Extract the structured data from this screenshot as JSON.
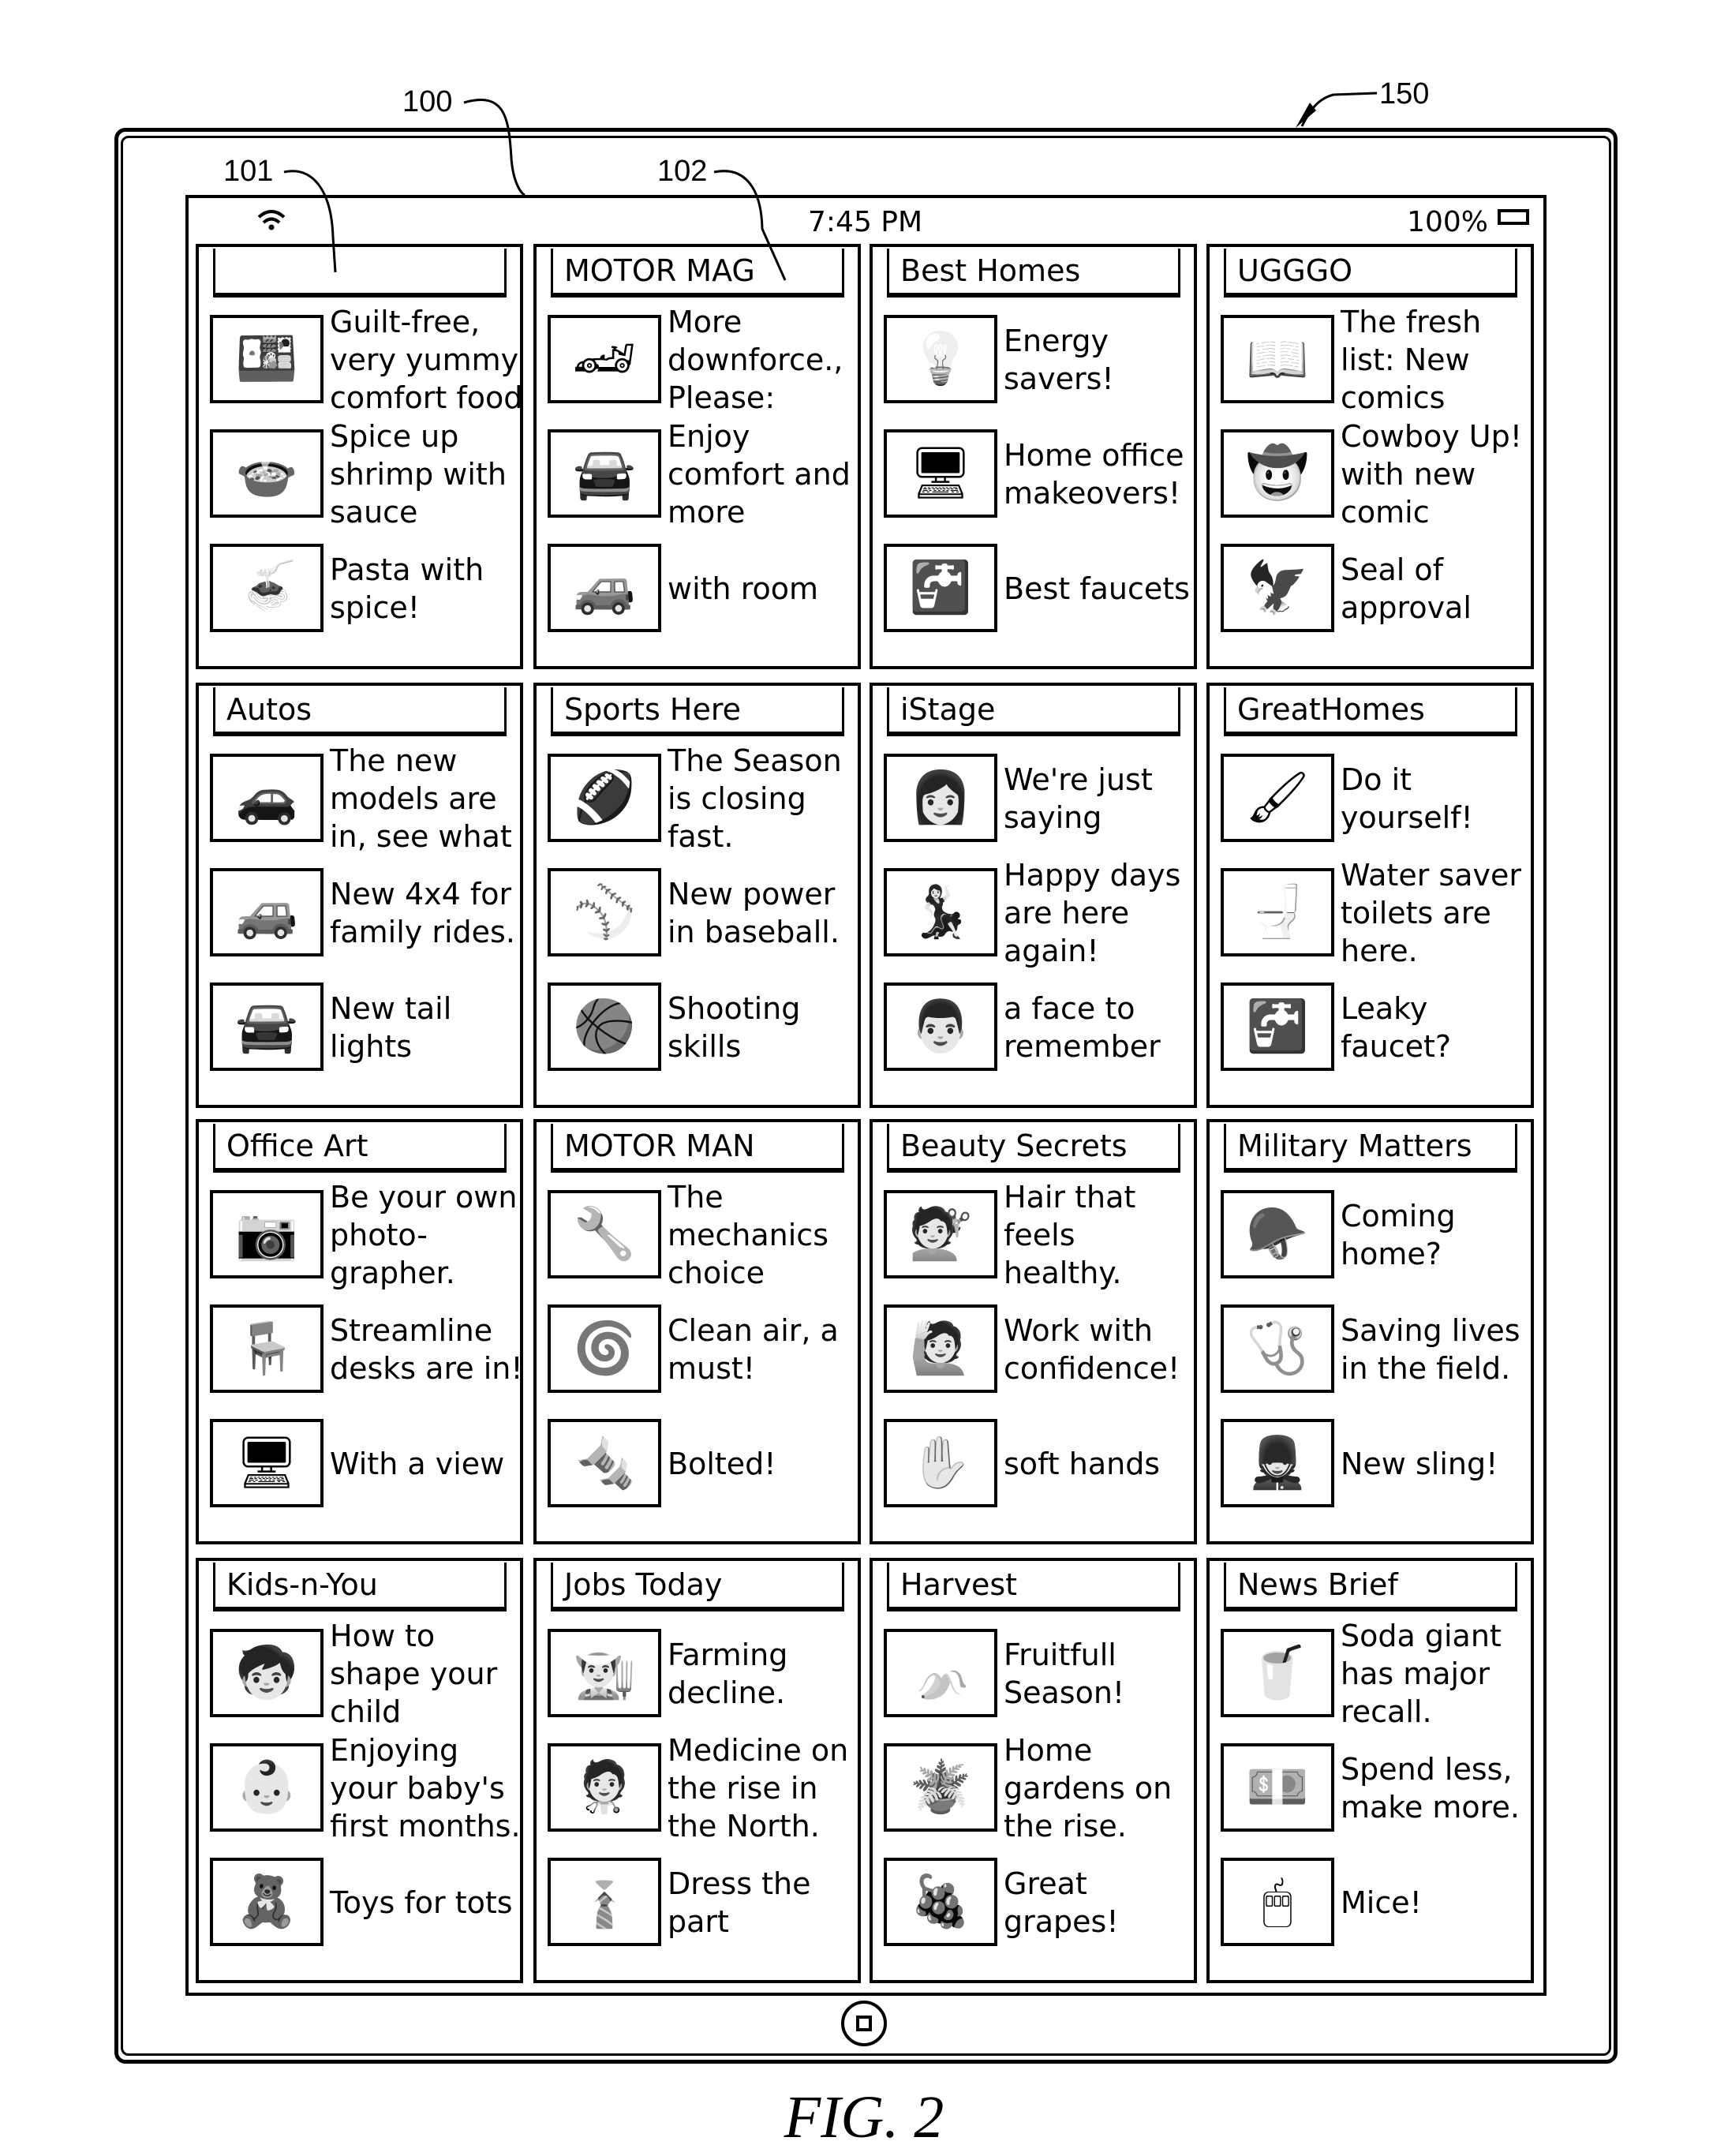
{
  "reference_labels": {
    "device": "150",
    "screen": "100",
    "panel": "101",
    "panel_title": "102"
  },
  "status_bar": {
    "wifi_icon": "wifi-icon",
    "time": "7:45 PM",
    "battery_pct": "100%",
    "battery_icon": "battery-icon"
  },
  "panels": [
    {
      "title": "",
      "items": [
        {
          "icon": "food-platter-icon",
          "glyph": "🍱",
          "text": "Guilt-free, very yummy comfort food"
        },
        {
          "icon": "shrimp-bowl-icon",
          "glyph": "🍲",
          "text": "Spice up shrimp with sauce"
        },
        {
          "icon": "pasta-bowl-icon",
          "glyph": "🍝",
          "text": "Pasta with spice!"
        }
      ]
    },
    {
      "title": "MOTOR MAG",
      "items": [
        {
          "icon": "sports-car-icon",
          "glyph": "🏎",
          "text": "More downforce., Please:"
        },
        {
          "icon": "car-front-icon",
          "glyph": "🚘",
          "text": "Enjoy comfort and more"
        },
        {
          "icon": "suv-icon",
          "glyph": "🚙",
          "text": "with room"
        }
      ]
    },
    {
      "title": "Best Homes",
      "items": [
        {
          "icon": "light-bulb-icon",
          "glyph": "💡",
          "text": "Energy savers!"
        },
        {
          "icon": "home-office-icon",
          "glyph": "🖥",
          "text": "Home office makeovers!"
        },
        {
          "icon": "faucet-icon",
          "glyph": "🚰",
          "text": "Best faucets"
        }
      ]
    },
    {
      "title": "UGGGO",
      "items": [
        {
          "icon": "open-book-icon",
          "glyph": "📖",
          "text": "The fresh list: New comics"
        },
        {
          "icon": "cowboy-icon",
          "glyph": "🤠",
          "text": "Cowboy Up! with new comic"
        },
        {
          "icon": "eagle-seal-icon",
          "glyph": "🦅",
          "text": "Seal of approval"
        }
      ]
    },
    {
      "title": "Autos",
      "items": [
        {
          "icon": "sedan-icon",
          "glyph": "🚗",
          "text": "The new models are in, see what"
        },
        {
          "icon": "4x4-icon",
          "glyph": "🚙",
          "text": "New 4x4 for family rides."
        },
        {
          "icon": "car-rear-icon",
          "glyph": "🚘",
          "text": "New tail lights"
        }
      ]
    },
    {
      "title": "Sports Here",
      "items": [
        {
          "icon": "football-player-icon",
          "glyph": "🏈",
          "text": "The Season is closing fast."
        },
        {
          "icon": "baseball-player-icon",
          "glyph": "⚾",
          "text": "New power in baseball."
        },
        {
          "icon": "basketball-player-icon",
          "glyph": "🏀",
          "text": "Shooting skills"
        }
      ]
    },
    {
      "title": "iStage",
      "items": [
        {
          "icon": "woman-portrait-icon",
          "glyph": "👩",
          "text": "We're just saying"
        },
        {
          "icon": "dancers-icon",
          "glyph": "💃",
          "text": "Happy days are here again!"
        },
        {
          "icon": "man-portrait-icon",
          "glyph": "👨",
          "text": "a face to remember"
        }
      ]
    },
    {
      "title": "GreatHomes",
      "items": [
        {
          "icon": "paint-brush-icon",
          "glyph": "🖌",
          "text": "Do it yourself!"
        },
        {
          "icon": "toilet-icon",
          "glyph": "🚽",
          "text": "Water saver toilets are here."
        },
        {
          "icon": "leaky-faucet-icon",
          "glyph": "🚰",
          "text": "Leaky faucet?"
        }
      ]
    },
    {
      "title": "Office Art",
      "items": [
        {
          "icon": "camera-icon",
          "glyph": "📷",
          "text": "Be your own photo-grapher."
        },
        {
          "icon": "desk-icon",
          "glyph": "🪑",
          "text": "Streamline desks are in!"
        },
        {
          "icon": "monitor-icon",
          "glyph": "🖥",
          "text": "With a view"
        }
      ]
    },
    {
      "title": "MOTOR MAN",
      "items": [
        {
          "icon": "mechanic-icon",
          "glyph": "🔧",
          "text": "The mechanics choice"
        },
        {
          "icon": "air-filter-icon",
          "glyph": "🌀",
          "text": "Clean air, a must!"
        },
        {
          "icon": "bolt-icon",
          "glyph": "🔩",
          "text": "Bolted!"
        }
      ]
    },
    {
      "title": "Beauty Secrets",
      "items": [
        {
          "icon": "hair-icon",
          "glyph": "💇",
          "text": "Hair that feels healthy."
        },
        {
          "icon": "confident-woman-icon",
          "glyph": "🙋",
          "text": "Work with confidence!"
        },
        {
          "icon": "hand-icon",
          "glyph": "✋",
          "text": "soft hands"
        }
      ]
    },
    {
      "title": "Military Matters",
      "items": [
        {
          "icon": "soldier-helmet-icon",
          "glyph": "🪖",
          "text": "Coming home?"
        },
        {
          "icon": "medic-icon",
          "glyph": "🩺",
          "text": "Saving lives in the field."
        },
        {
          "icon": "soldier-icon",
          "glyph": "💂",
          "text": "New sling!"
        }
      ]
    },
    {
      "title": "Kids-n-You",
      "items": [
        {
          "icon": "child-icon",
          "glyph": "🧒",
          "text": "How to shape your child"
        },
        {
          "icon": "baby-icon",
          "glyph": "👶",
          "text": "Enjoying your baby's first months."
        },
        {
          "icon": "teddy-bear-icon",
          "glyph": "🧸",
          "text": "Toys for tots"
        }
      ]
    },
    {
      "title": "Jobs Today",
      "items": [
        {
          "icon": "farmer-icon",
          "glyph": "👨‍🌾",
          "text": "Farming decline."
        },
        {
          "icon": "doctor-icon",
          "glyph": "🧑‍⚕️",
          "text": "Medicine on the rise in the North."
        },
        {
          "icon": "shirt-icon",
          "glyph": "👔",
          "text": "Dress the part"
        }
      ]
    },
    {
      "title": "Harvest",
      "items": [
        {
          "icon": "banana-icon",
          "glyph": "🍌",
          "text": "Fruitfull Season!"
        },
        {
          "icon": "potted-plant-icon",
          "glyph": "🪴",
          "text": "Home gardens on the rise."
        },
        {
          "icon": "grapes-icon",
          "glyph": "🍇",
          "text": "Great grapes!"
        }
      ]
    },
    {
      "title": "News Brief",
      "items": [
        {
          "icon": "soda-bottles-icon",
          "glyph": "🥤",
          "text": "Soda giant has major recall."
        },
        {
          "icon": "money-icon",
          "glyph": "💵",
          "text": "Spend less, make more."
        },
        {
          "icon": "computer-mouse-icon",
          "glyph": "🖱",
          "text": "Mice!"
        }
      ]
    }
  ],
  "home_button_icon": "home-button-icon",
  "figure_caption": "FIG. 2"
}
